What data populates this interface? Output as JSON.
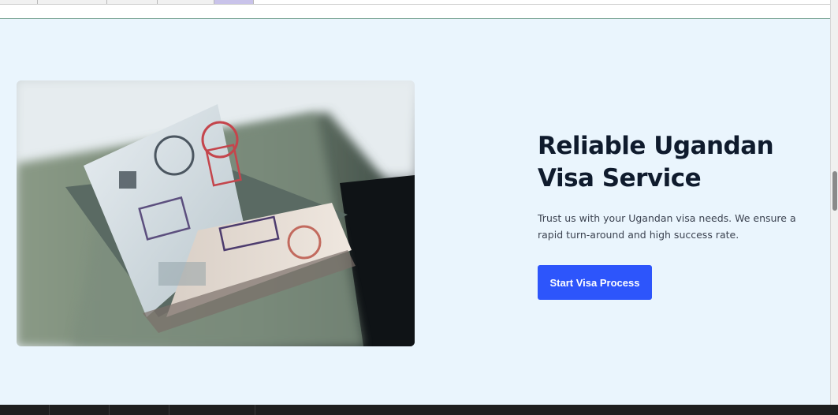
{
  "hero": {
    "title": "Reliable Ugandan Visa Service",
    "description": "Trust us with your Ugandan visa needs. We ensure a rapid turn-around and high success rate.",
    "cta_label": "Start Visa Process"
  },
  "colors": {
    "hero_background": "#eaf5fd",
    "title": "#0f1b2d",
    "accent": "#2d55fb"
  },
  "icons": [
    "passport-photo"
  ]
}
